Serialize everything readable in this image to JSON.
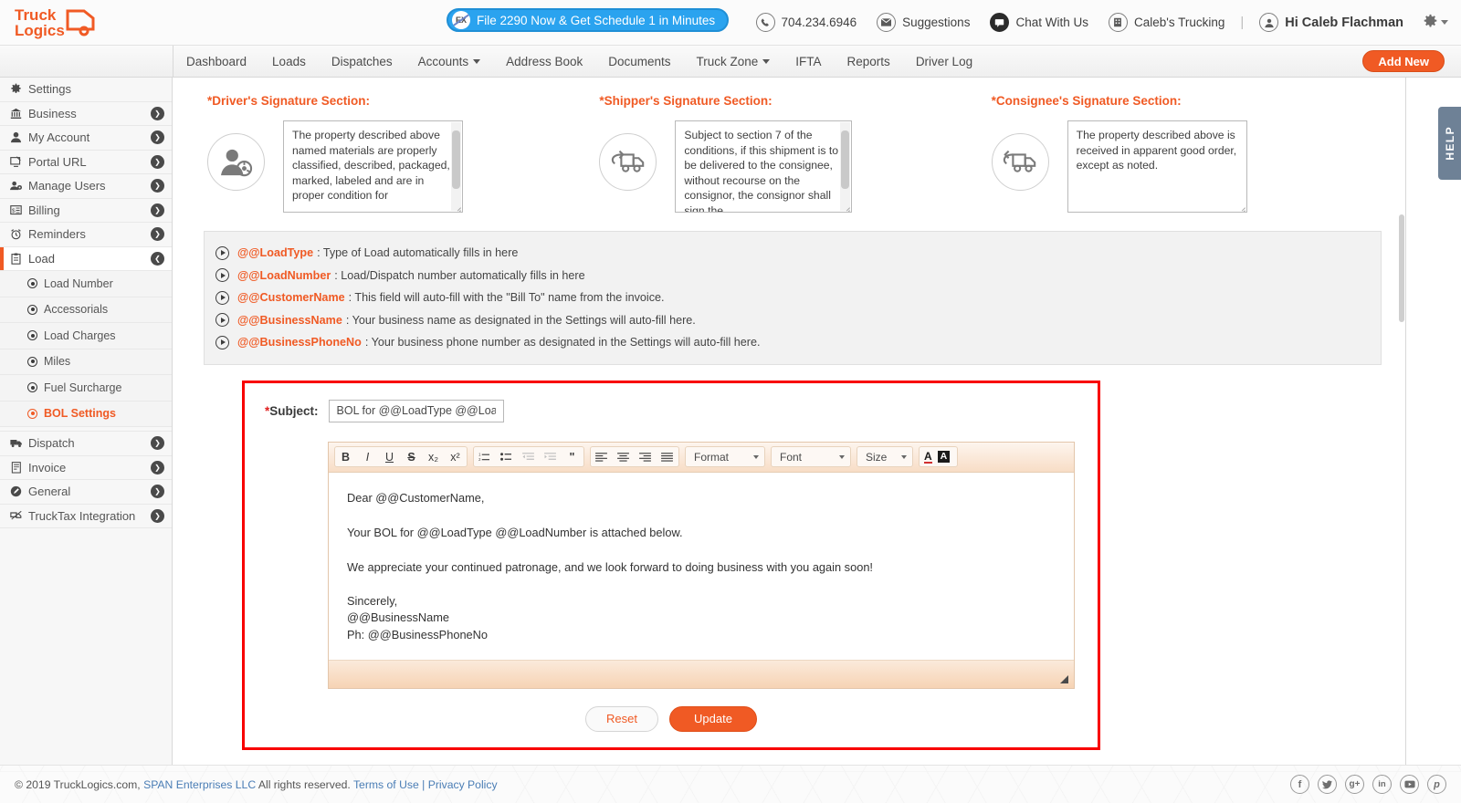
{
  "brand": {
    "name_line1": "Truck",
    "name_line2": "Logics",
    "color": "#f05a24"
  },
  "header": {
    "promo": {
      "label": "File 2290 Now & Get Schedule 1 in Minutes",
      "icon": "ex-2290-icon",
      "bg": "#2aa3ef"
    },
    "phone": "704.234.6946",
    "suggestions": "Suggestions",
    "chat": "Chat With Us",
    "company": "Caleb's Trucking",
    "divider": "|",
    "greeting": "Hi Caleb Flachman",
    "gear": "gear-icon"
  },
  "nav": {
    "items": [
      {
        "label": "Dashboard",
        "caret": false
      },
      {
        "label": "Loads",
        "caret": false
      },
      {
        "label": "Dispatches",
        "caret": false
      },
      {
        "label": "Accounts",
        "caret": true
      },
      {
        "label": "Address Book",
        "caret": false
      },
      {
        "label": "Documents",
        "caret": false
      },
      {
        "label": "Truck Zone",
        "caret": true
      },
      {
        "label": "IFTA",
        "caret": false
      },
      {
        "label": "Reports",
        "caret": false
      },
      {
        "label": "Driver Log",
        "caret": false
      }
    ],
    "add_new": "Add New"
  },
  "sidebar": {
    "items": [
      {
        "label": "Settings",
        "icon": "gear-icon",
        "chevron": false,
        "active": false
      },
      {
        "label": "Business",
        "icon": "bank-icon",
        "chevron": true,
        "active": false
      },
      {
        "label": "My Account",
        "icon": "user-icon",
        "chevron": true,
        "active": false
      },
      {
        "label": "Portal URL",
        "icon": "monitor-icon",
        "chevron": true,
        "active": false
      },
      {
        "label": "Manage Users",
        "icon": "users-gear-icon",
        "chevron": true,
        "active": false
      },
      {
        "label": "Billing",
        "icon": "invoice-dollar-icon",
        "chevron": true,
        "active": false
      },
      {
        "label": "Reminders",
        "icon": "alarm-clock-icon",
        "chevron": true,
        "active": false
      },
      {
        "label": "Load",
        "icon": "clipboard-icon",
        "chevron": true,
        "active": true
      }
    ],
    "sub_items": [
      {
        "label": "Load Number",
        "current": false
      },
      {
        "label": "Accessorials",
        "current": false
      },
      {
        "label": "Load Charges",
        "current": false
      },
      {
        "label": "Miles",
        "current": false
      },
      {
        "label": "Fuel Surcharge",
        "current": false
      },
      {
        "label": "BOL Settings",
        "current": true
      }
    ],
    "items_after": [
      {
        "label": "Dispatch",
        "icon": "truck-icon",
        "chevron": true
      },
      {
        "label": "Invoice",
        "icon": "invoice-icon",
        "chevron": true
      },
      {
        "label": "General",
        "icon": "pencil-circle-icon",
        "chevron": true
      },
      {
        "label": "TruckTax Integration",
        "icon": "trucktax-icon",
        "chevron": true
      }
    ]
  },
  "signatures": [
    {
      "title": "*Driver's Signature Section:",
      "icon": "driver-avatar-icon",
      "text": "The property described above named materials are properly classified, described, packaged, marked, labeled and are in proper condition for",
      "scrollbar": true
    },
    {
      "title": "*Shipper's Signature Section:",
      "icon": "shipper-truck-icon",
      "text": "Subject to section 7 of the conditions, if this shipment is to be delivered to the consignee, without recourse on the consignor, the consignor shall sign the",
      "scrollbar": true
    },
    {
      "title": "*Consignee's Signature Section:",
      "icon": "consignee-truck-icon",
      "text": "The property described above is received in apparent good order, except as noted.",
      "scrollbar": false
    }
  ],
  "legend": [
    {
      "var": "@@LoadType",
      "desc": " : Type of Load automatically fills in here"
    },
    {
      "var": "@@LoadNumber",
      "desc": ": Load/Dispatch number automatically fills in here"
    },
    {
      "var": "@@CustomerName",
      "desc": ":  This field will auto-fill with the \"Bill To\" name from the invoice."
    },
    {
      "var": "@@BusinessName",
      "desc": ":  Your business name as designated in the Settings will auto-fill here."
    },
    {
      "var": "@@BusinessPhoneNo",
      "desc": " :  Your business phone number as designated in the Settings will auto-fill here."
    }
  ],
  "form": {
    "highlight_color": "#f80000",
    "subject_label": "Subject:",
    "subject_star": "*",
    "subject_value": "BOL for @@LoadType @@LoadN",
    "editor": {
      "toolbar": {
        "bold": "B",
        "italic": "I",
        "underline": "U",
        "strike": "S",
        "subscript": "x₂",
        "superscript": "x²",
        "ordered_list": "ordered-list-icon",
        "unordered_list": "bulleted-list-icon",
        "outdent": "outdent-icon",
        "indent": "indent-icon",
        "blockquote": "\"",
        "align_left": "align-left-icon",
        "align_center": "align-center-icon",
        "align_right": "align-right-icon",
        "align_justify": "align-justify-icon",
        "format": "Format",
        "font": "Font",
        "size": "Size",
        "text_color": "A",
        "bg_color": "A"
      },
      "body": [
        "Dear @@CustomerName,",
        "Your BOL for @@LoadType @@LoadNumber is attached below.",
        "We appreciate your continued patronage, and we look forward to doing business with you again soon!"
      ],
      "signoff": [
        "Sincerely,",
        "@@BusinessName",
        "Ph: @@BusinessPhoneNo"
      ]
    },
    "reset_label": "Reset",
    "update_label": "Update"
  },
  "help_tab": "HELP",
  "footer": {
    "copyright": "© 2019 TruckLogics.com,",
    "company_link": "SPAN Enterprises LLC",
    "rights": "All rights reserved.",
    "terms": "Terms of Use",
    "pipe": "|",
    "privacy": "Privacy Policy",
    "social": [
      "facebook-icon",
      "twitter-icon",
      "google-plus-icon",
      "linkedin-icon",
      "youtube-icon",
      "pinterest-icon"
    ]
  }
}
